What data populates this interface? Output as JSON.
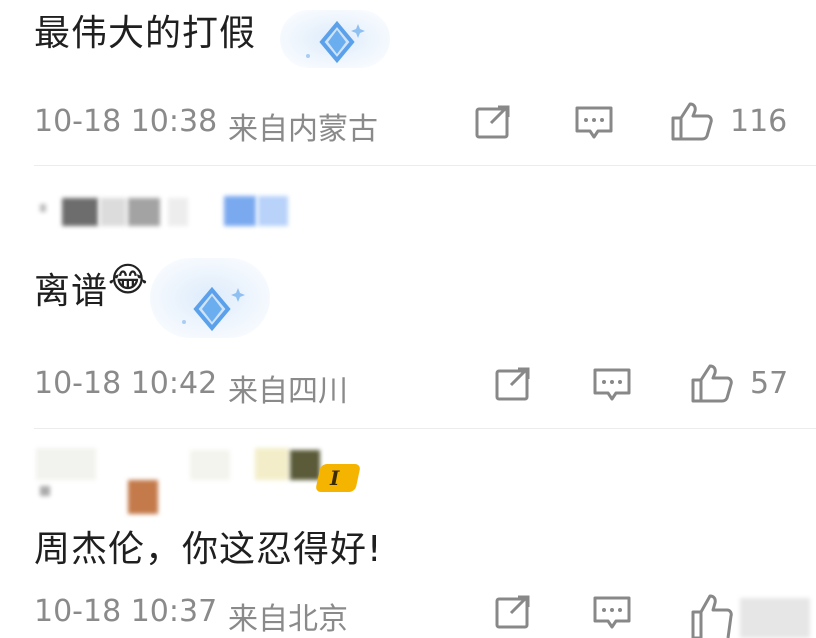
{
  "comments": [
    {
      "text": "最伟大的打假",
      "timestamp": "10-18 10:38",
      "location": "来自内蒙古",
      "likes": "116",
      "icons": [
        "share-icon",
        "comment-icon",
        "thumbs-up-icon"
      ]
    },
    {
      "text": "离谱",
      "emoji": "😂",
      "timestamp": "10-18 10:42",
      "location": "来自四川",
      "likes": "57",
      "icons": [
        "share-icon",
        "comment-icon",
        "thumbs-up-icon"
      ]
    },
    {
      "text": "周杰伦，你这忍得好!",
      "timestamp": "10-18 10:37",
      "location": "来自北京",
      "badge_text": "I",
      "icons": [
        "share-icon",
        "comment-icon",
        "thumbs-up-icon"
      ]
    }
  ],
  "colors": {
    "text": "#1f1f1f",
    "meta": "#8a8a8a",
    "badge": "#f5b400",
    "sticker": "#5aa0ea"
  }
}
